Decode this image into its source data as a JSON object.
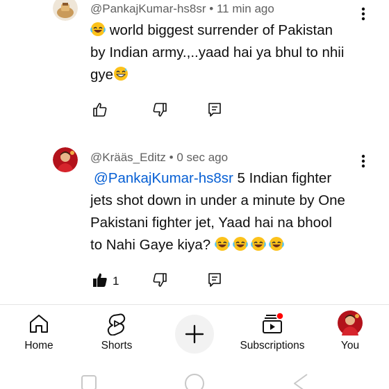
{
  "comments": [
    {
      "author": "@PankajKumar-hs8sr",
      "separator": "•",
      "time": "11 min ago",
      "line1_text": " world biggest surrender of Pakistan",
      "line2_text": "by Indian army.,..yaad hai ya bhul to nhii",
      "line3_text": "gye",
      "emoji_before": "laughing-face",
      "emoji_after": "grinning-sweat-face"
    },
    {
      "author": "@Krääs_Editz",
      "separator": "•",
      "time": "0 sec ago",
      "mention": "@PankajKumar-hs8sr",
      "line1_text": "  5 Indian fighter",
      "line2_text": "jets shot down in under a minute by One",
      "line3_text": "Pakistani fighter jet, Yaad hai na bhool",
      "line4_text": "to Nahi Gaye kiya? ",
      "trailing_emoji": [
        "laughing-face",
        "laughing-face",
        "laughing-face",
        "laughing-face"
      ],
      "like_count": "1"
    }
  ],
  "nav": {
    "home": "Home",
    "shorts": "Shorts",
    "subscriptions": "Subscriptions",
    "you": "You"
  },
  "colors": {
    "mention": "#065fd4",
    "meta": "#606060",
    "notification_dot": "#ff0000"
  }
}
